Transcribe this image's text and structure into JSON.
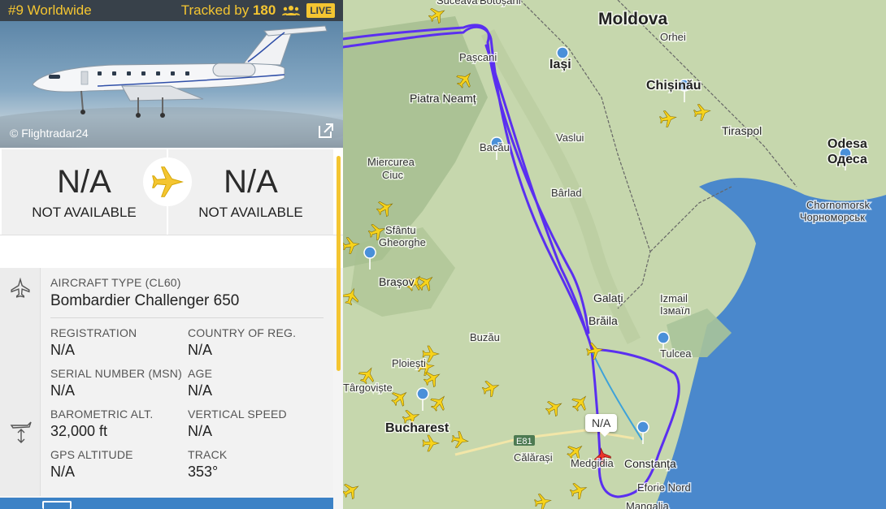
{
  "header": {
    "rank": "#9 Worldwide",
    "tracked_prefix": "Tracked by",
    "tracked_count": "180",
    "live": "LIVE"
  },
  "photo": {
    "credit": "© Flightradar24"
  },
  "route": {
    "origin_code": "N/A",
    "origin_city": "NOT AVAILABLE",
    "dest_code": "N/A",
    "dest_city": "NOT AVAILABLE"
  },
  "details": {
    "aircraft_type_label": "AIRCRAFT TYPE",
    "aircraft_type_code": "(CL60)",
    "aircraft_type_value": "Bombardier Challenger 650",
    "registration_label": "REGISTRATION",
    "registration_value": "N/A",
    "country_label": "COUNTRY OF REG.",
    "country_value": "N/A",
    "serial_label": "SERIAL NUMBER (MSN)",
    "serial_value": "N/A",
    "age_label": "AGE",
    "age_value": "N/A",
    "baro_label": "BAROMETRIC ALT.",
    "baro_value": "32,000 ft",
    "vspeed_label": "VERTICAL SPEED",
    "vspeed_value": "N/A",
    "gps_label": "GPS ALTITUDE",
    "gps_value": "N/A",
    "track_label": "TRACK",
    "track_value": "353°"
  },
  "map": {
    "callout": "N/A",
    "labels": {
      "moldova": "Moldova",
      "chisinau": "Chișinău",
      "orhei": "Orhei",
      "tiraspol": "Tiraspol",
      "odesa": "Odesa",
      "odesa_cyr": "Одеса",
      "iasi": "Iași",
      "vaslui": "Vaslui",
      "piatra": "Piatra Neamț",
      "pascani": "Pașcani",
      "suceava": "Suceava",
      "botosani": "Botoșani",
      "bacau": "Bacău",
      "miercurea": "Miercurea",
      "ciuc": "Ciuc",
      "barlad": "Bârlad",
      "sfantu": "Sfântu",
      "gheorghe": "Gheorghe",
      "brasov": "Brașov",
      "galati": "Galați",
      "braila": "Brăila",
      "izmail": "Izmail",
      "izmail_cyr": "Ізмаїл",
      "tulcea": "Tulcea",
      "buzau": "Buzău",
      "ploiesti": "Ploiești",
      "targoviste": "Târgoviște",
      "bucharest": "Bucharest",
      "calarasi": "Călărași",
      "medgidia": "Medgidia",
      "constanta": "Constanța",
      "eforie": "Eforie Nord",
      "mangalia": "Mangalia",
      "chornomorsk": "Chornomorsk",
      "chornomorsk_cyr": "Чорноморськ",
      "e81": "E81"
    }
  },
  "colors": {
    "track": "#5a2ff0",
    "sea": "#4a88cc",
    "land": "#c5d6ab",
    "accent": "#f4c531",
    "plane": "#f7d31b"
  }
}
